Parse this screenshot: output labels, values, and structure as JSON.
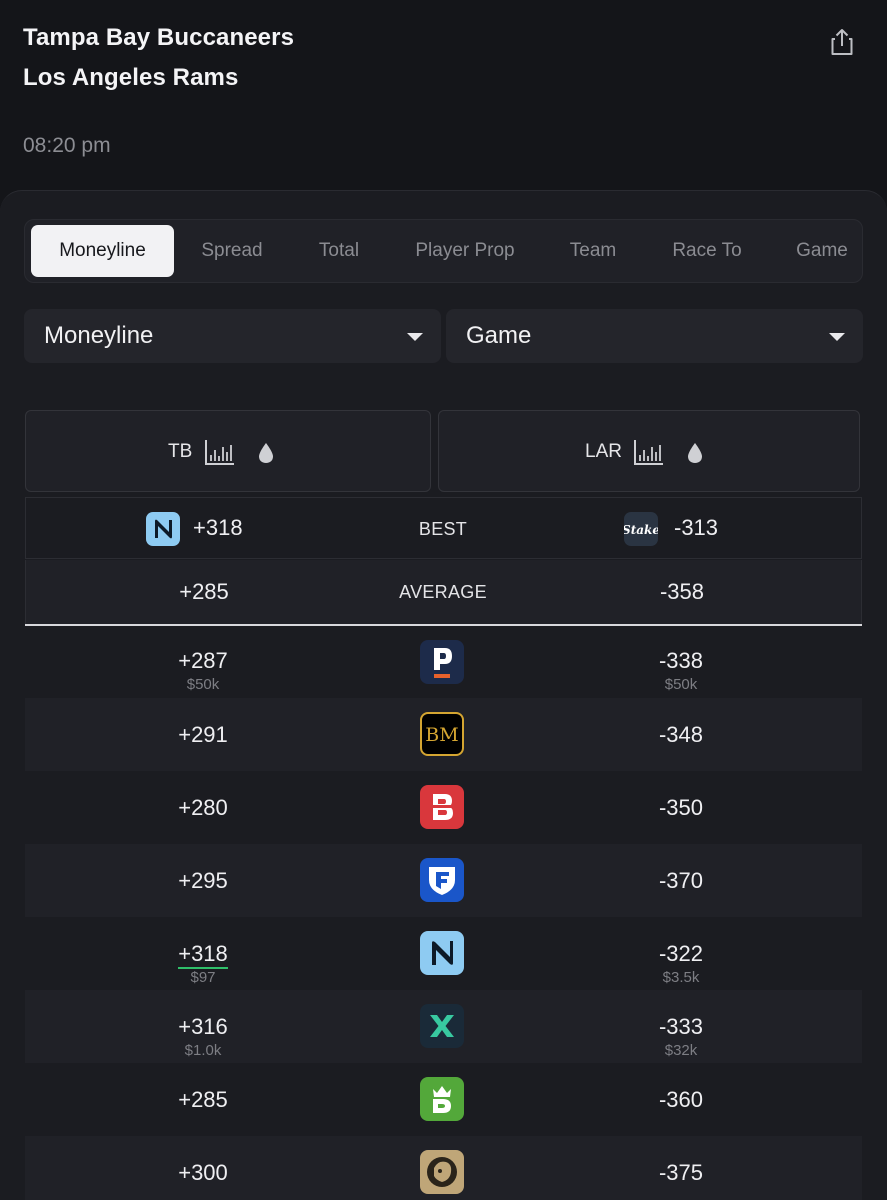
{
  "event": {
    "home_team": "Tampa Bay Buccaneers",
    "away_team": "Los Angeles Rams",
    "time": "08:20 pm",
    "share_icon": "share-icon"
  },
  "tabs": [
    {
      "label": "Moneyline",
      "active": true
    },
    {
      "label": "Spread",
      "active": false
    },
    {
      "label": "Total",
      "active": false
    },
    {
      "label": "Player Prop",
      "active": false
    },
    {
      "label": "Team",
      "active": false
    },
    {
      "label": "Race To",
      "active": false
    },
    {
      "label": "Game",
      "active": false
    }
  ],
  "filters": {
    "market": "Moneyline",
    "period": "Game"
  },
  "columns": {
    "left": {
      "abbr": "TB",
      "icons": [
        "bar-chart-icon",
        "droplet-icon"
      ]
    },
    "right": {
      "abbr": "LAR",
      "icons": [
        "bar-chart-icon",
        "droplet-icon"
      ]
    }
  },
  "summary": {
    "best": {
      "label": "BEST",
      "left": "+318",
      "right": "-313",
      "left_book": "novig",
      "right_book": "stake"
    },
    "average": {
      "label": "AVERAGE",
      "left": "+285",
      "right": "-358"
    }
  },
  "books": [
    {
      "book": "prophetx",
      "left": "+287",
      "left_limit": "$50k",
      "right": "-338",
      "right_limit": "$50k"
    },
    {
      "book": "betmgm-bm",
      "left": "+291",
      "left_limit": "",
      "right": "-348",
      "right_limit": ""
    },
    {
      "book": "betrivers",
      "left": "+280",
      "left_limit": "",
      "right": "-350",
      "right_limit": ""
    },
    {
      "book": "fanduel",
      "left": "+295",
      "left_limit": "",
      "right": "-370",
      "right_limit": ""
    },
    {
      "book": "novig",
      "left": "+318",
      "left_limit": "$97",
      "right": "-322",
      "right_limit": "$3.5k",
      "left_best": true
    },
    {
      "book": "sporttrade",
      "left": "+316",
      "left_limit": "$1.0k",
      "right": "-333",
      "right_limit": "$32k"
    },
    {
      "book": "draftkings",
      "left": "+285",
      "left_limit": "",
      "right": "-360",
      "right_limit": ""
    },
    {
      "book": "betmgm",
      "left": "+300",
      "left_limit": "",
      "right": "-375",
      "right_limit": ""
    }
  ],
  "colors": {
    "background": "#141519",
    "panel": "#1b1c21",
    "active_tab": "#f2f2f4",
    "best_underline": "#2fbf6a"
  }
}
